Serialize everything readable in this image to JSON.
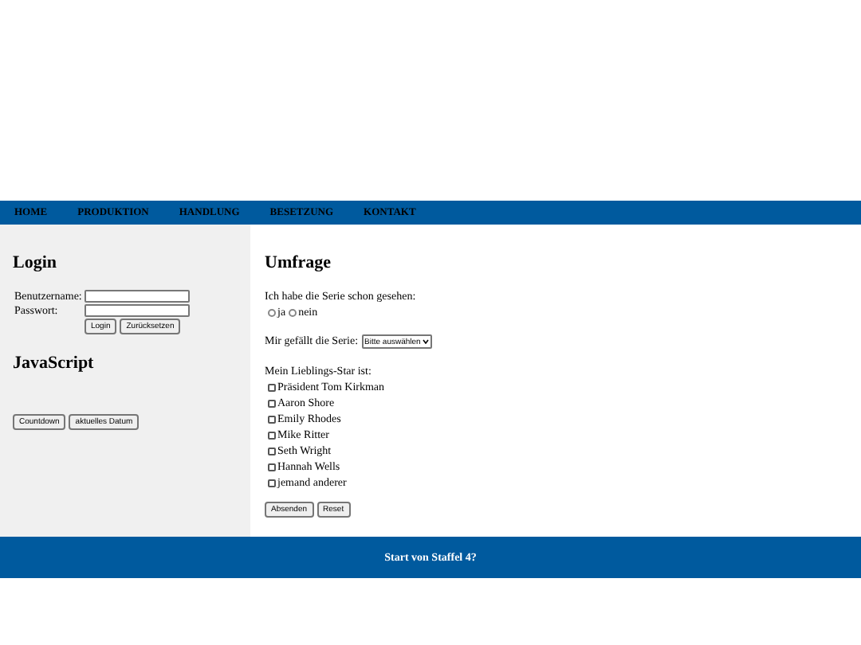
{
  "nav": [
    {
      "label": "HOME"
    },
    {
      "label": "PRODUKTION"
    },
    {
      "label": "HANDLUNG"
    },
    {
      "label": "BESETZUNG"
    },
    {
      "label": "KONTAKT"
    }
  ],
  "sidebar": {
    "login": {
      "title": "Login",
      "fields": [
        {
          "label": "Benutzername:"
        },
        {
          "label": "Passwort:"
        }
      ],
      "buttons": [
        "Login",
        "Zurücksetzen"
      ]
    },
    "javascript": {
      "title": "JavaScript",
      "buttons": [
        "Countdown",
        "aktuelles Datum"
      ]
    }
  },
  "survey": {
    "title": "Umfrage",
    "seen_question": "Ich habe die Serie schon gesehen:",
    "seen_options": [
      {
        "label": "ja",
        "selected": false
      },
      {
        "label": "nein",
        "selected": false
      }
    ],
    "like_question": "Mir gefällt die Serie:",
    "like_select": "Bitte auswählen",
    "star_question": "Mein Lieblings-Star ist:",
    "stars": [
      {
        "label": "Präsident Tom Kirkman",
        "checked": false
      },
      {
        "label": "Aaron Shore",
        "checked": false
      },
      {
        "label": "Emily Rhodes",
        "checked": false
      },
      {
        "label": "Mike Ritter",
        "checked": false
      },
      {
        "label": "Seth Wright",
        "checked": false
      },
      {
        "label": "Hannah Wells",
        "checked": false
      },
      {
        "label": "jemand anderer",
        "checked": false
      }
    ],
    "buttons": [
      "Absenden",
      "Reset"
    ]
  },
  "footer": "Start von Staffel 4?"
}
